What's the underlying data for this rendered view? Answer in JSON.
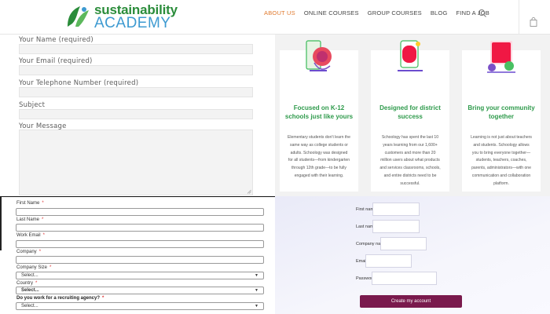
{
  "header": {
    "logo_line1": "sustainability",
    "logo_line2": "ACADEMY",
    "nav": [
      "ABOUT US",
      "ONLINE COURSES",
      "GROUP COURSES",
      "BLOG",
      "FIND A JOB"
    ],
    "active_nav": "ABOUT US",
    "brand_green": "#2a8c3a",
    "brand_blue": "#3d9ad1",
    "accent_orange": "#e07a2f"
  },
  "contact_form": {
    "name_label": "Your Name (required)",
    "email_label": "Your Email (required)",
    "phone_label": "Your Telephone Number (required)",
    "subject_label": "Subject",
    "message_label": "Your Message"
  },
  "cards": [
    {
      "title": "Focused on K-12 schools just like yours",
      "body": "Elementary students don't learn the same way as college students or adults. Schoology was designed for all students—from kindergarten through 12th grade—to be fully engaged with their learning."
    },
    {
      "title": "Designed for district success",
      "body": "Schoology has spent the last 10 years learning from our 1,600+ customers and more than 20 million users about what products and services classrooms, schools, and entire districts need to be successful."
    },
    {
      "title": "Bring your community together",
      "body": "Learning is not just about teachers and students. Schoology allows you to bring everyone together—students, teachers, coaches, parents, administrators—with one communication and collaboration platform."
    }
  ],
  "signup_form": {
    "first_name": "First Name",
    "last_name": "Last Name",
    "work_email": "Work Email",
    "company": "Company",
    "company_size": "Company Size",
    "company_size_value": "Select...",
    "country": "Country",
    "country_value": "Select...",
    "recruiting": "Do you work for a recruiting agency?",
    "recruiting_value": "Select...",
    "required_mark": "*"
  },
  "account_form": {
    "first_name": "First name",
    "last_name": "Last name",
    "company_name": "Company name",
    "email": "Email",
    "password": "Password",
    "button": "Create my account",
    "button_color": "#7a1a4d"
  }
}
